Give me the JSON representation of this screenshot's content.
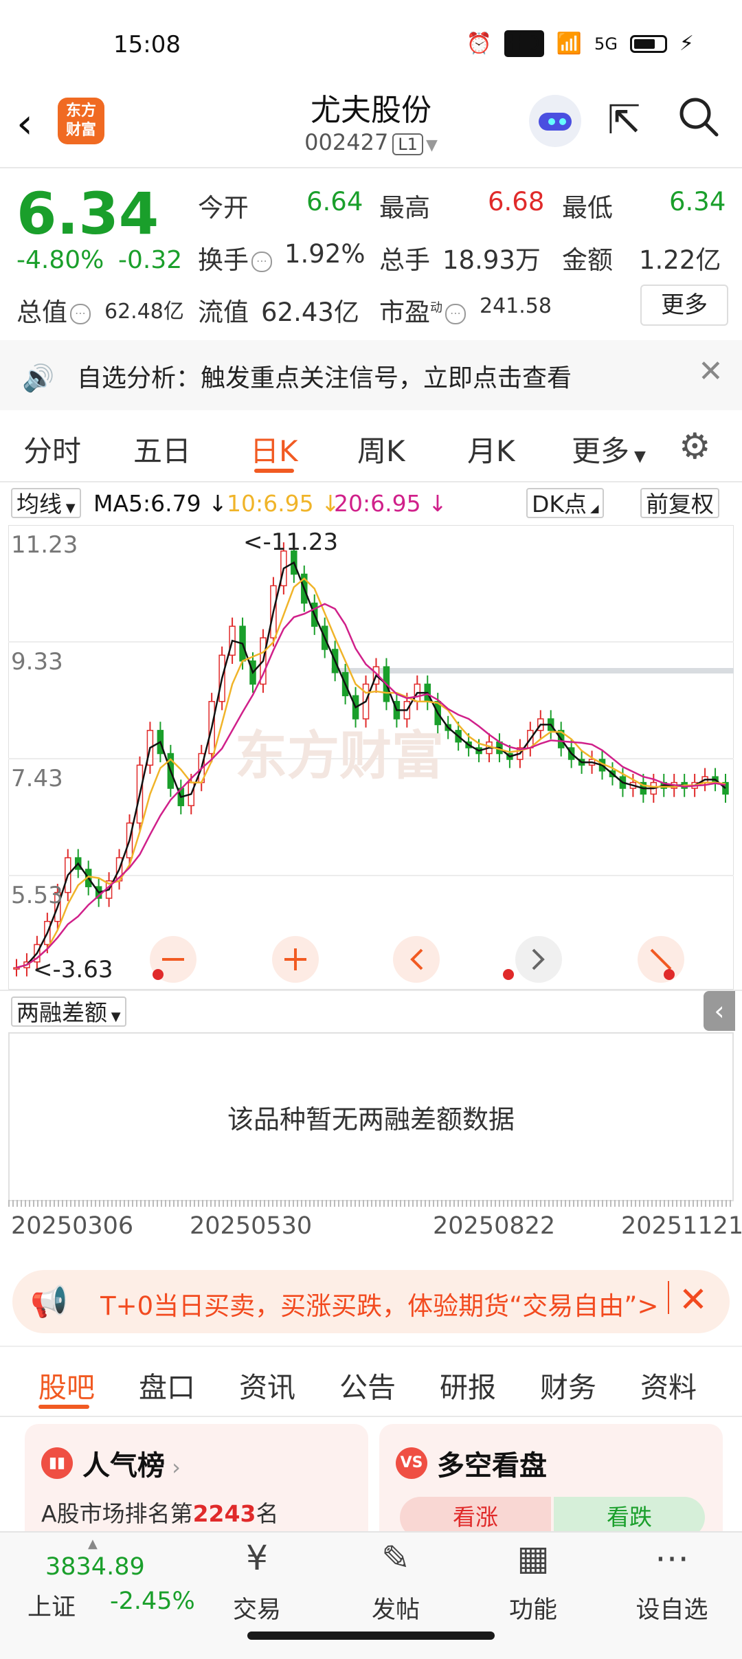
{
  "status_bar": {
    "time": "15:08",
    "hd": "HD",
    "signal": "5G"
  },
  "header": {
    "logo_text_1": "东方",
    "logo_text_2": "财富",
    "stock_name": "尤夫股份",
    "stock_code": "002427",
    "level": "L1"
  },
  "quote": {
    "price": "6.34",
    "change_pct": "-4.80%",
    "change": "-0.32",
    "open_label": "今开",
    "open": "6.64",
    "high_label": "最高",
    "high": "6.68",
    "low_label": "最低",
    "low": "6.34",
    "turnover_label": "换手",
    "turnover": "1.92%",
    "volume_label": "总手",
    "volume": "18.93万",
    "amount_label": "金额",
    "amount": "1.22亿",
    "mktcap_label": "总值",
    "mktcap": "62.48亿",
    "float_label": "流值",
    "float": "62.43亿",
    "pe_label": "市盈",
    "pe_sup": "动",
    "pe": "241.58",
    "more": "更多"
  },
  "notice": {
    "text": "自选分析：触发重点关注信号，立即点击查看"
  },
  "tabs": [
    "分时",
    "五日",
    "日K",
    "周K",
    "月K",
    "更多"
  ],
  "active_tab": "日K",
  "indicator": {
    "selector": "均线",
    "ma5": "MA5:6.79",
    "ma10": "10:6.95",
    "ma20": "20:6.95",
    "dk": "DK点",
    "adjust": "前复权"
  },
  "colors": {
    "up": "#e02a2a",
    "down": "#1a9f2b",
    "accent": "#f15a22",
    "ma5": "#111111",
    "ma10": "#f0b429",
    "ma20": "#d0208a"
  },
  "chart_data": {
    "type": "candlestick",
    "price_labels": [
      "11.23",
      "9.33",
      "7.43",
      "5.53"
    ],
    "max_marker": "<-11.23",
    "min_marker": "<-3.63",
    "watermark": "东方财富",
    "ylim": [
      3.63,
      11.23
    ],
    "dates": [
      "20250306",
      "20250530",
      "20250822",
      "20251121"
    ],
    "close_trend": [
      3.7,
      3.8,
      4.1,
      4.5,
      5.0,
      5.6,
      5.4,
      5.1,
      4.9,
      5.2,
      5.6,
      6.2,
      7.2,
      7.8,
      7.4,
      6.8,
      6.5,
      6.9,
      7.4,
      8.3,
      9.1,
      9.6,
      9.0,
      8.6,
      9.4,
      10.3,
      10.9,
      10.5,
      10.0,
      9.6,
      9.2,
      8.8,
      8.4,
      8.0,
      8.6,
      8.9,
      8.3,
      8.0,
      8.3,
      8.6,
      8.3,
      7.9,
      7.8,
      7.6,
      7.5,
      7.4,
      7.6,
      7.4,
      7.3,
      7.5,
      7.8,
      8.0,
      7.8,
      7.5,
      7.3,
      7.2,
      7.3,
      7.1,
      7.0,
      6.8,
      6.9,
      6.7,
      6.9,
      6.8,
      6.9,
      6.8,
      6.9,
      7.0,
      6.9,
      6.7
    ]
  },
  "second_panel": {
    "selector": "两融差额",
    "empty_message": "该品种暂无两融差额数据"
  },
  "promo": {
    "text": "T+0当日买卖，买涨买跌，体验期货“交易自由”>"
  },
  "bottom_tabs": [
    "股吧",
    "盘口",
    "资讯",
    "公告",
    "研报",
    "财务",
    "资料"
  ],
  "cards": {
    "popularity": {
      "title": "人气榜",
      "rank_prefix": "A股市场排名第",
      "rank": "2243",
      "rank_suffix": "名"
    },
    "longshort": {
      "title": "多空看盘",
      "up": "看涨",
      "down": "看跌"
    }
  },
  "bottom_nav": {
    "index_value": "3834.89",
    "index_name": "上证",
    "index_change": "-2.45%",
    "items": [
      "交易",
      "发帖",
      "功能",
      "设自选"
    ]
  }
}
